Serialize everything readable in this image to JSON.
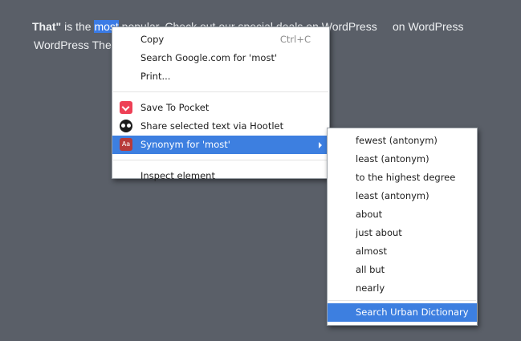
{
  "page": {
    "line1": {
      "bold": "That\"",
      "pre": " is the ",
      "selected": "most",
      "underlined": " popular",
      "post": ".  Check out our special deals on WordPress",
      "tail": "on WordPress"
    },
    "line2": "WordPress The"
  },
  "context_menu": {
    "copy": "Copy",
    "copy_shortcut": "Ctrl+C",
    "search": "Search Google.com for 'most'",
    "print": "Print...",
    "pocket": "Save To Pocket",
    "hootlet": "Share selected text via Hootlet",
    "synonym": "Synonym for 'most'",
    "inspect": "Inspect element"
  },
  "submenu": {
    "items": [
      "fewest (antonym)",
      "least (antonym)",
      "to the highest degree",
      "least (antonym)",
      "about",
      "just about",
      "almost",
      "all but",
      "nearly"
    ],
    "search_urban": "Search Urban Dictionary"
  },
  "icons": {
    "pocket": "pocket-icon",
    "hootlet": "hootlet-owl-icon",
    "dictionary": "dictionary-icon",
    "submenu_arrow": "chevron-right-icon"
  },
  "colors": {
    "background": "#5a5f68",
    "highlight": "#3d7fe0",
    "selection": "#3a7be6"
  }
}
